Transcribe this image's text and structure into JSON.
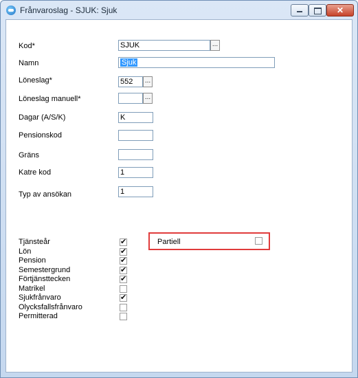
{
  "window": {
    "title": "Frånvaroslag - SJUK: Sjuk",
    "controls": {
      "minimize": "minimize",
      "maximize": "maximize",
      "close": "✕"
    }
  },
  "form": {
    "kod": {
      "label": "Kod*",
      "value": "SJUK"
    },
    "namn": {
      "label": "Namn",
      "value": "Sjuk"
    },
    "loneslag": {
      "label": "Löneslag*",
      "value": "552"
    },
    "loneslag_manuell": {
      "label": "Löneslag manuell*",
      "value": ""
    },
    "dagar": {
      "label": "Dagar (A/S/K)",
      "value": "K"
    },
    "pensionskod": {
      "label": "Pensionskod",
      "value": ""
    },
    "grans": {
      "label": "Gräns",
      "value": ""
    },
    "katre_kod": {
      "label": "Katre kod",
      "value": "1"
    },
    "typ_av_ansokan": {
      "label": "Typ av ansökan",
      "value": "1"
    },
    "ellipsis": "..."
  },
  "checkboxes": [
    {
      "label": "Tjänsteår",
      "checked": true
    },
    {
      "label": "Lön",
      "checked": true
    },
    {
      "label": "Pension",
      "checked": true
    },
    {
      "label": "Semestergrund",
      "checked": true
    },
    {
      "label": "Förtjänsttecken",
      "checked": true
    },
    {
      "label": "Matrikel",
      "checked": false
    },
    {
      "label": "Sjukfrånvaro",
      "checked": true
    },
    {
      "label": "Olycksfallsfrånvaro",
      "checked": false
    },
    {
      "label": "Permitterad",
      "checked": false
    }
  ],
  "partiell": {
    "label": "Partiell",
    "checked": false
  },
  "colors": {
    "highlight": "#e03b3b",
    "selection": "#3399ff"
  }
}
